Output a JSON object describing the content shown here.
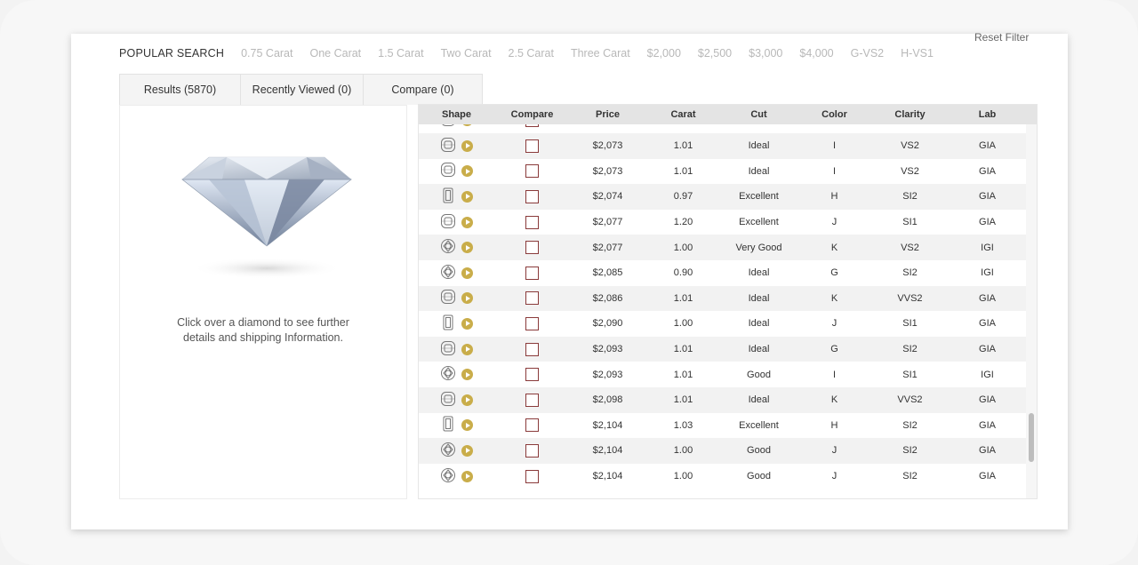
{
  "reset_filter": "Reset Filter",
  "popular": {
    "label": "POPULAR SEARCH",
    "chips": [
      "0.75 Carat",
      "One Carat",
      "1.5 Carat",
      "Two Carat",
      "2.5 Carat",
      "Three Carat",
      "$2,000",
      "$2,500",
      "$3,000",
      "$4,000",
      "G-VS2",
      "H-VS1"
    ]
  },
  "tabs": [
    "Results (5870)",
    "Recently Viewed (0)",
    "Compare (0)"
  ],
  "panel": {
    "info_line1": "Click over a diamond to see further",
    "info_line2": "details and shipping Information."
  },
  "table": {
    "headers": [
      "Shape",
      "Compare",
      "Price",
      "Carat",
      "Cut",
      "Color",
      "Clarity",
      "Lab"
    ],
    "rows": [
      {
        "shape": "cushion-icon",
        "price": "$2,073",
        "carat": "1.01",
        "cut": "Ideal",
        "color": "I",
        "clarity": "VS2",
        "lab": "GIA"
      },
      {
        "shape": "cushion-icon",
        "price": "$2,073",
        "carat": "1.01",
        "cut": "Ideal",
        "color": "I",
        "clarity": "VS2",
        "lab": "GIA"
      },
      {
        "shape": "emerald-icon",
        "price": "$2,074",
        "carat": "0.97",
        "cut": "Excellent",
        "color": "H",
        "clarity": "SI2",
        "lab": "GIA"
      },
      {
        "shape": "cushion-icon",
        "price": "$2,077",
        "carat": "1.20",
        "cut": "Excellent",
        "color": "J",
        "clarity": "SI1",
        "lab": "GIA"
      },
      {
        "shape": "round-icon",
        "price": "$2,077",
        "carat": "1.00",
        "cut": "Very Good",
        "color": "K",
        "clarity": "VS2",
        "lab": "IGI"
      },
      {
        "shape": "round-icon",
        "price": "$2,085",
        "carat": "0.90",
        "cut": "Ideal",
        "color": "G",
        "clarity": "SI2",
        "lab": "IGI"
      },
      {
        "shape": "cushion-icon",
        "price": "$2,086",
        "carat": "1.01",
        "cut": "Ideal",
        "color": "K",
        "clarity": "VVS2",
        "lab": "GIA"
      },
      {
        "shape": "emerald-icon",
        "price": "$2,090",
        "carat": "1.00",
        "cut": "Ideal",
        "color": "J",
        "clarity": "SI1",
        "lab": "GIA"
      },
      {
        "shape": "cushion-icon",
        "price": "$2,093",
        "carat": "1.01",
        "cut": "Ideal",
        "color": "G",
        "clarity": "SI2",
        "lab": "GIA"
      },
      {
        "shape": "round-icon",
        "price": "$2,093",
        "carat": "1.01",
        "cut": "Good",
        "color": "I",
        "clarity": "SI1",
        "lab": "IGI"
      },
      {
        "shape": "radiant-icon",
        "price": "$2,098",
        "carat": "1.01",
        "cut": "Ideal",
        "color": "K",
        "clarity": "VVS2",
        "lab": "GIA"
      },
      {
        "shape": "emerald-icon",
        "price": "$2,104",
        "carat": "1.03",
        "cut": "Excellent",
        "color": "H",
        "clarity": "SI2",
        "lab": "GIA"
      },
      {
        "shape": "round-icon",
        "price": "$2,104",
        "carat": "1.00",
        "cut": "Good",
        "color": "J",
        "clarity": "SI2",
        "lab": "GIA"
      },
      {
        "shape": "round-icon",
        "price": "$2,104",
        "carat": "1.00",
        "cut": "Good",
        "color": "J",
        "clarity": "SI2",
        "lab": "GIA"
      }
    ]
  },
  "colors": {
    "accent_gold": "#c9ad4a",
    "checkbox_border": "#8a3a3a",
    "header_bg": "#e4e4e4"
  }
}
